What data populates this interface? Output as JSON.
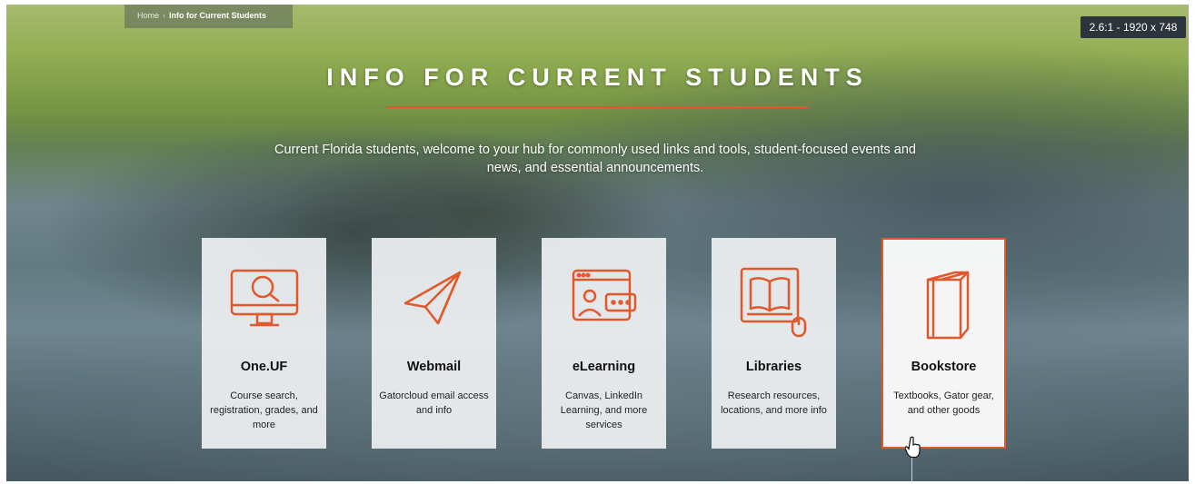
{
  "breadcrumb": {
    "home": "Home",
    "separator": "›",
    "current": "Info for Current Students"
  },
  "resolution_badge": "2.6:1 - 1920 x 748",
  "hero": {
    "title": "INFO FOR CURRENT STUDENTS",
    "intro": "Current Florida students, welcome to your hub for commonly used links and tools, student-focused events and news, and essential announcements."
  },
  "accent_color": "#e2582a",
  "cards": [
    {
      "icon": "monitor-search-icon",
      "name": "One.UF",
      "desc": "Course search, registration, grades, and more"
    },
    {
      "icon": "paper-plane-icon",
      "name": "Webmail",
      "desc": "Gatorcloud email access and info"
    },
    {
      "icon": "online-learning-icon",
      "name": "eLearning",
      "desc": "Canvas, LinkedIn Learning, and more services"
    },
    {
      "icon": "book-monitor-icon",
      "name": "Libraries",
      "desc": "Research resources, locations, and more info"
    },
    {
      "icon": "book-icon",
      "name": "Bookstore",
      "desc": "Textbooks, Gator gear, and other goods",
      "hovered": true
    }
  ]
}
